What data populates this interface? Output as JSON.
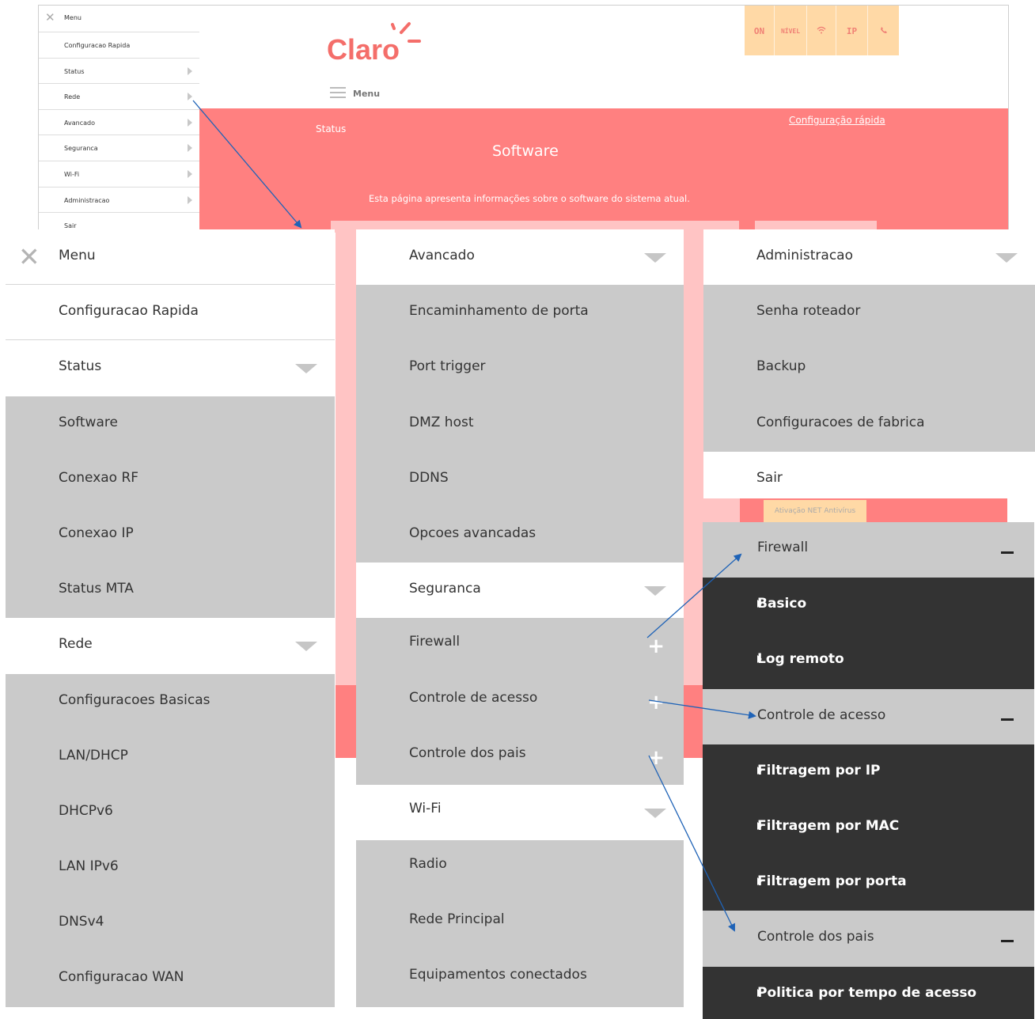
{
  "colors": {
    "brand_red": "#ff8080",
    "light_pink": "#ffc4c4",
    "status_bg": "#ffd9a6",
    "menu_gray": "#cacaca",
    "dark_submenu": "#333333",
    "arrow": "#1f63b7"
  },
  "mini_menu": {
    "close_icon": "close-icon",
    "title": "Menu",
    "items": [
      "Configuracao Rapida",
      "Status",
      "Rede",
      "Avancado",
      "Seguranca",
      "Wi-Fi",
      "Administracao",
      "Sair"
    ]
  },
  "header": {
    "logo_text": "Claro",
    "menu_label": "Menu",
    "status_icons": [
      "ON",
      "NÍVEL",
      "wifi-icon",
      "IP",
      "phone-icon"
    ]
  },
  "page": {
    "breadcrumb": "Status",
    "quick_config_link": "Configuração rápida",
    "title": "Software",
    "description": "Esta página apresenta informações sobre o software do sistema atual.",
    "antivirus_button": "Ativação NET Antivírus"
  },
  "col1": {
    "menu_title": "Menu",
    "configuracao_rapida": "Configuracao Rapida",
    "status_header": "Status",
    "status_items": [
      "Software",
      "Conexao RF",
      "Conexao IP",
      "Status MTA"
    ],
    "rede_header": "Rede",
    "rede_items": [
      "Configuracoes Basicas",
      "LAN/DHCP",
      "DHCPv6",
      "LAN IPv6",
      "DNSv4",
      "Configuracao WAN"
    ]
  },
  "col2": {
    "avancado_header": "Avancado",
    "avancado_items": [
      "Encaminhamento de porta",
      "Port trigger",
      "DMZ host",
      "DDNS",
      "Opcoes avancadas"
    ],
    "seguranca_header": "Seguranca",
    "seguranca_items": [
      "Firewall",
      "Controle de acesso",
      "Controle dos pais"
    ],
    "wifi_header": "Wi-Fi",
    "wifi_items": [
      "Radio",
      "Rede Principal",
      "Equipamentos conectados"
    ]
  },
  "col3": {
    "admin_header": "Administracao",
    "admin_items": [
      "Senha roteador",
      "Backup",
      "Configuracoes de fabrica"
    ],
    "sair": "Sair"
  },
  "col4": {
    "firewall_header": "Firewall",
    "firewall_items": [
      "Basico",
      "Log remoto"
    ],
    "acesso_header": "Controle de acesso",
    "acesso_items": [
      "Filtragem por IP",
      "Filtragem por MAC",
      "Filtragem por porta"
    ],
    "pais_header": "Controle dos pais",
    "pais_items": [
      "Politica por tempo de acesso"
    ]
  }
}
